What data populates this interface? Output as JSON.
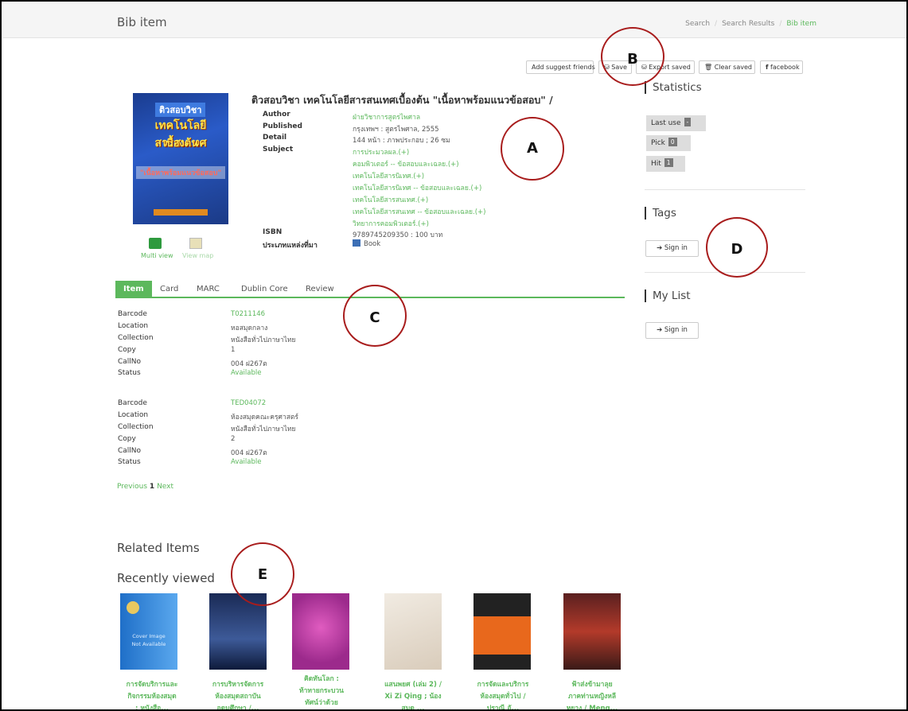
{
  "header": {
    "title": "Bib item",
    "breadcrumb": [
      "Search",
      "Search Results",
      "Bib item"
    ]
  },
  "toolbar": {
    "suggest": "Add suggest friends",
    "save": "Save",
    "export": "Export saved",
    "clear": "Clear saved",
    "facebook": "facebook"
  },
  "cover": {
    "line1": "ติวสอบวิชา",
    "line2": "เทคโนโลยีสารสนเทศ",
    "line3": "เบื้องต้น",
    "line4": "\"เนื้อหาพร้อมแนวข้อสอบ\""
  },
  "view_buttons": {
    "multi": "Multi view",
    "map": "View map"
  },
  "book": {
    "title": "ติวสอบวิชา เทคโนโลยีสารสนเทศเบื้องต้น \"เนื้อหาพร้อมแนวข้อสอบ\" /",
    "labels": {
      "author": "Author",
      "published": "Published",
      "detail": "Detail",
      "subject": "Subject",
      "isbn": "ISBN",
      "type": "ประเภทแหล่งที่มา"
    },
    "author": "ฝ่ายวิชาการสูตรไพศาล",
    "published": "กรุงเทพฯ : สูตรไพศาล, 2555",
    "detail": "144 หน้า : ภาพประกอบ ; 26 ซม",
    "subjects": [
      "การประมวลผล.(+)",
      "คอมพิวเตอร์ -- ข้อสอบและเฉลย.(+)",
      "เทคโนโลยีสารนิเทศ.(+)",
      "เทคโนโลยีสารนิเทศ -- ข้อสอบและเฉลย.(+)",
      "เทคโนโลยีสารสนเทศ.(+)",
      "เทคโนโลยีสารสนเทศ -- ข้อสอบและเฉลย.(+)",
      "วิทยาการคอมพิวเตอร์.(+)"
    ],
    "isbn": "9789745209350 : 100 บาท",
    "type": "Book"
  },
  "sidebar": {
    "statistics": "Statistics",
    "stats": [
      {
        "label": "Last use",
        "value": "-"
      },
      {
        "label": "Pick",
        "value": "0"
      },
      {
        "label": "Hit",
        "value": "1"
      }
    ],
    "tags": "Tags",
    "sign_in": "Sign in",
    "my_list": "My List"
  },
  "tabs": [
    "Item",
    "Card",
    "MARC",
    "Dublin Core",
    "Review"
  ],
  "item_labels": {
    "barcode": "Barcode",
    "location": "Location",
    "collection": "Collection",
    "copy": "Copy",
    "callno": "CallNo",
    "status": "Status"
  },
  "items": [
    {
      "barcode": "T0211146",
      "location": "หอสมุดกลาง",
      "collection": "หนังสือทั่วไปภาษาไทย",
      "copy": "1",
      "callno": "004 ฝ267ต",
      "status": "Available"
    },
    {
      "barcode": "TED04072",
      "location": "ห้องสมุดคณะครุศาสตร์",
      "collection": "หนังสือทั่วไปภาษาไทย",
      "copy": "2",
      "callno": "004 ฝ267ต",
      "status": "Available"
    }
  ],
  "pager": {
    "prev": "Previous",
    "page": "1",
    "next": "Next"
  },
  "related": "Related Items",
  "recent": {
    "title": "Recently viewed",
    "placeholder": [
      "Cover Image",
      "Not Available"
    ],
    "items": [
      [
        "การจัดบริการและ",
        "กิจกรรมห้องสมุด",
        ": หนังสือ..."
      ],
      [
        "การบริหารจัดการ",
        "ห้องสมุดสถาบัน",
        "อุดมศึกษา /..."
      ],
      [
        "คิดทันโลก :",
        "ท้าทายกระบวน",
        "ทัศน์ว่าด้วย"
      ],
      [
        "แสนพยศ (เล่ม 2) /",
        "Xi Zi Qing ; น้อง",
        "สมุด ..."
      ],
      [
        "การจัดและบริการ",
        "ห้องสมุดทั่วไป /",
        "ปราณี อั..."
      ],
      [
        "ฟ้าส่งข้ามาลุย",
        "ภาคท่านหญิงหลี",
        "หยาง / Meng..."
      ]
    ]
  },
  "annotations": [
    "A",
    "B",
    "C",
    "D",
    "E"
  ]
}
